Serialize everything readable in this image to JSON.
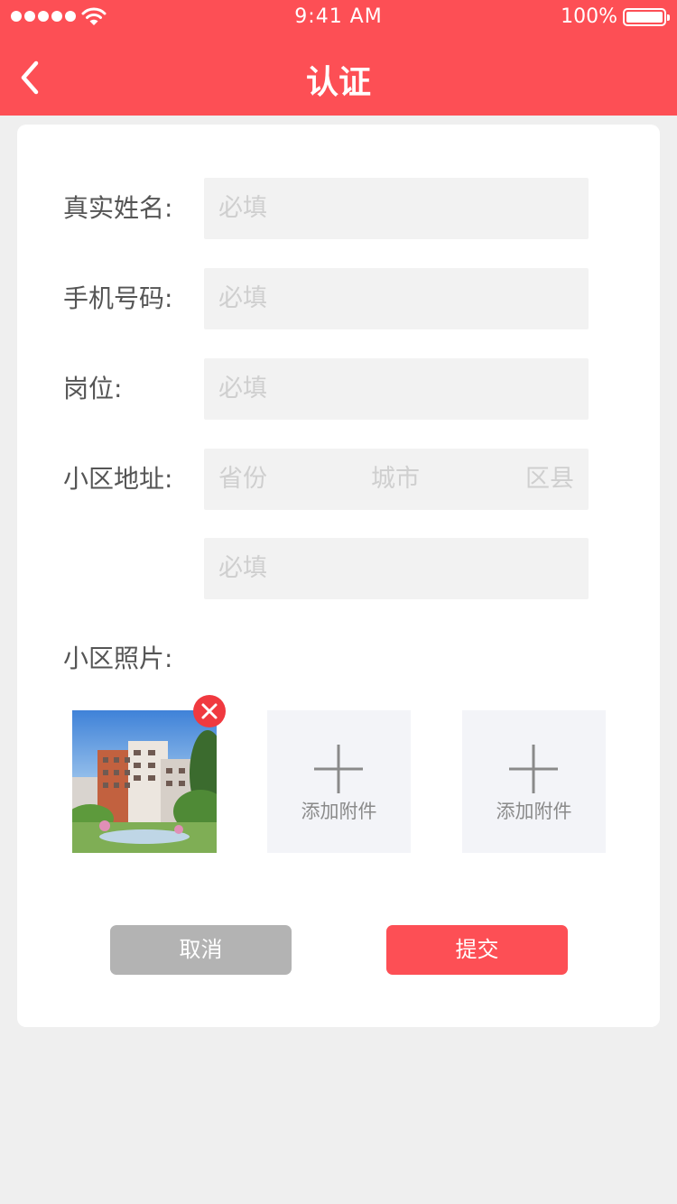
{
  "status_bar": {
    "time": "9:41 AM",
    "battery": "100%"
  },
  "nav": {
    "back_icon": "chevron-left-icon",
    "title": "认证"
  },
  "form": {
    "name": {
      "label": "真实姓名:",
      "placeholder": "必填"
    },
    "phone": {
      "label": "手机号码:",
      "placeholder": "必填"
    },
    "position": {
      "label": "岗位:",
      "placeholder": "必填"
    },
    "address": {
      "label": "小区地址:",
      "province": "省份",
      "city": "城市",
      "county": "区县",
      "detail_placeholder": "必填"
    },
    "photos": {
      "label": "小区照片:",
      "remove_icon": "close-icon",
      "add_icon": "plus-icon",
      "add_label_1": "添加附件",
      "add_label_2": "添加附件"
    }
  },
  "actions": {
    "cancel": "取消",
    "submit": "提交"
  },
  "colors": {
    "brand": "#fd4f55",
    "cancel": "#b3b3b3",
    "field_bg": "#f2f2f2",
    "placeholder": "#cfcfcf"
  }
}
